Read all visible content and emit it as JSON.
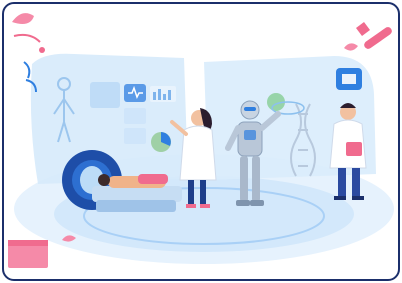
{
  "scene": {
    "subject": "medical-technology-illustration",
    "palette": {
      "frame": "#1b2f6b",
      "sky": "#e3f1fd",
      "panel": "#cde5fa",
      "accent_blue": "#2f7fe0",
      "pink": "#f06b8e",
      "robot": "#b9c7d8"
    },
    "icons": [
      "heart-monitor-icon",
      "thumbs-up-icon",
      "dna-icon",
      "spine-scan-icon",
      "clipboard-icon"
    ]
  }
}
